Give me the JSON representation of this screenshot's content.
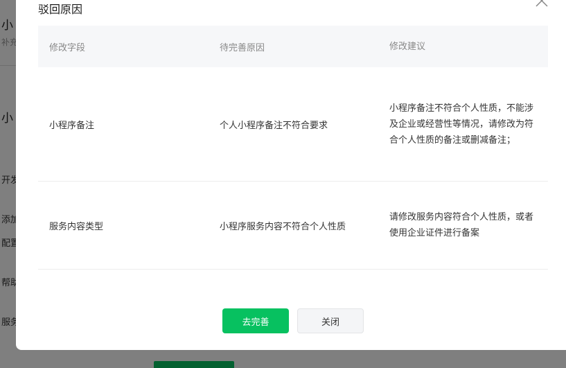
{
  "background": {
    "title_partial": "小",
    "subtitle_partial": "补充",
    "title2_partial": "小",
    "lines": [
      "开发",
      "添加",
      "配置",
      "帮助",
      "服务"
    ]
  },
  "dialog": {
    "title": "驳回原因",
    "columns": [
      "修改字段",
      "待完善原因",
      "修改建议"
    ],
    "rows": [
      {
        "field": "小程序备注",
        "reason": "个人小程序备注不符合要求",
        "suggestion": "小程序备注不符合个人性质，不能涉及企业或经营性等情况，请修改为符合个人性质的备注或删减备注；"
      },
      {
        "field": "服务内容类型",
        "reason": "小程序服务内容不符合个人性质",
        "suggestion": "请修改服务内容符合个人性质，或者使用企业证件进行备案"
      }
    ],
    "primary_button": "去完善",
    "secondary_button": "关闭"
  },
  "icons": {
    "close": "close-icon"
  },
  "colors": {
    "primary": "#07c160",
    "header_bg": "#f6f7f9"
  }
}
